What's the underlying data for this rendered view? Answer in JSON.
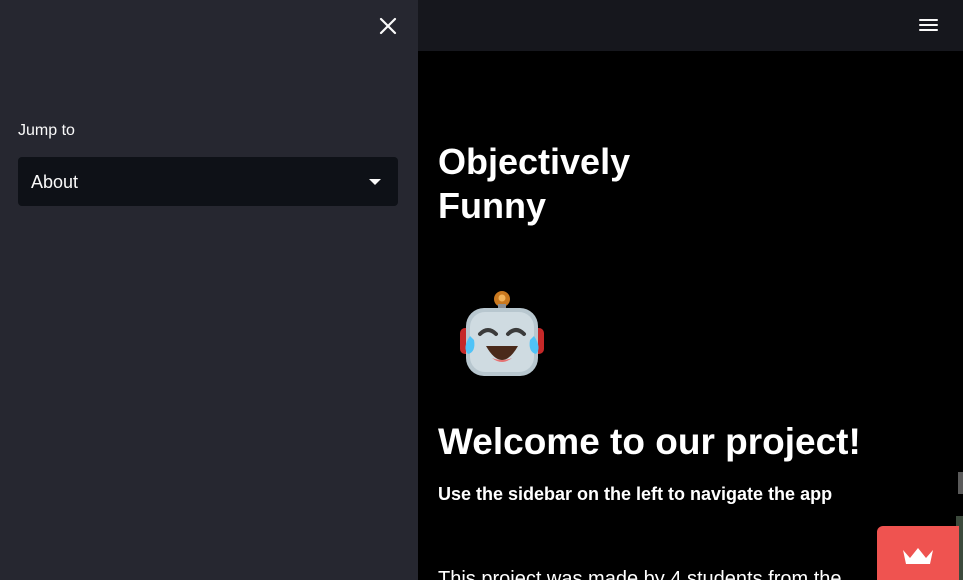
{
  "sidebar": {
    "close_icon": "close-icon",
    "jump_label": "Jump to",
    "select": {
      "selected": "About"
    }
  },
  "header": {
    "menu_icon": "hamburger-menu-icon"
  },
  "main": {
    "title": "Objectively Funny",
    "emoji_icon": "robot-tears-of-joy-icon",
    "welcome": "Welcome to our project!",
    "subtitle": "Use the sidebar on the left to navigate the app",
    "body_text": "This project was made by 4 students from the"
  },
  "badge": {
    "icon": "crown-icon"
  },
  "colors": {
    "sidebar_bg": "#262730",
    "select_bg": "#0e1117",
    "header_bg": "#16171d",
    "main_bg": "#000000",
    "badge_bg": "#ef5350"
  }
}
